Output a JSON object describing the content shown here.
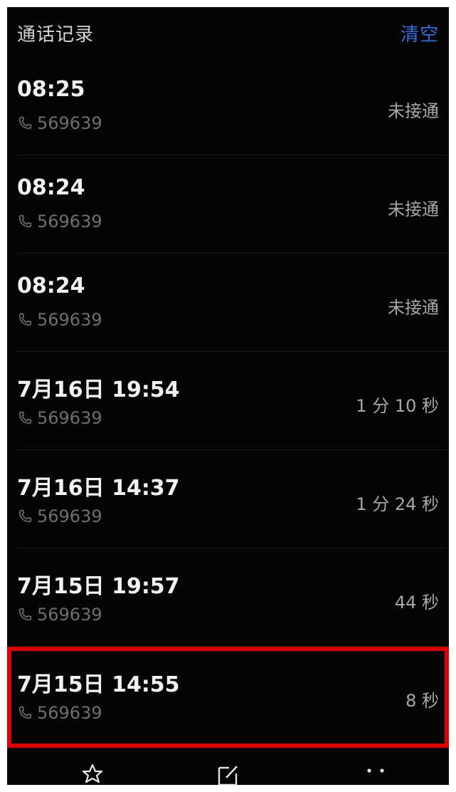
{
  "header": {
    "title": "通话记录",
    "action_label": "清空"
  },
  "calls": [
    {
      "time": "08:25",
      "number": "569639",
      "status": "未接通"
    },
    {
      "time": "08:24",
      "number": "569639",
      "status": "未接通"
    },
    {
      "time": "08:24",
      "number": "569639",
      "status": "未接通"
    },
    {
      "time": "7月16日 19:54",
      "number": "569639",
      "status": "1 分 10 秒"
    },
    {
      "time": "7月16日 14:37",
      "number": "569639",
      "status": "1 分 24 秒"
    },
    {
      "time": "7月15日 19:57",
      "number": "569639",
      "status": "44 秒"
    },
    {
      "time": "7月15日 14:55",
      "number": "569639",
      "status": "8 秒"
    }
  ],
  "highlighted_index": 6,
  "colors": {
    "background": "#050505",
    "accent": "#2f6fe0",
    "highlight": "#e00000"
  },
  "bottom_bar": {
    "icons": [
      "star-icon",
      "edit-icon",
      "more-icon"
    ]
  }
}
